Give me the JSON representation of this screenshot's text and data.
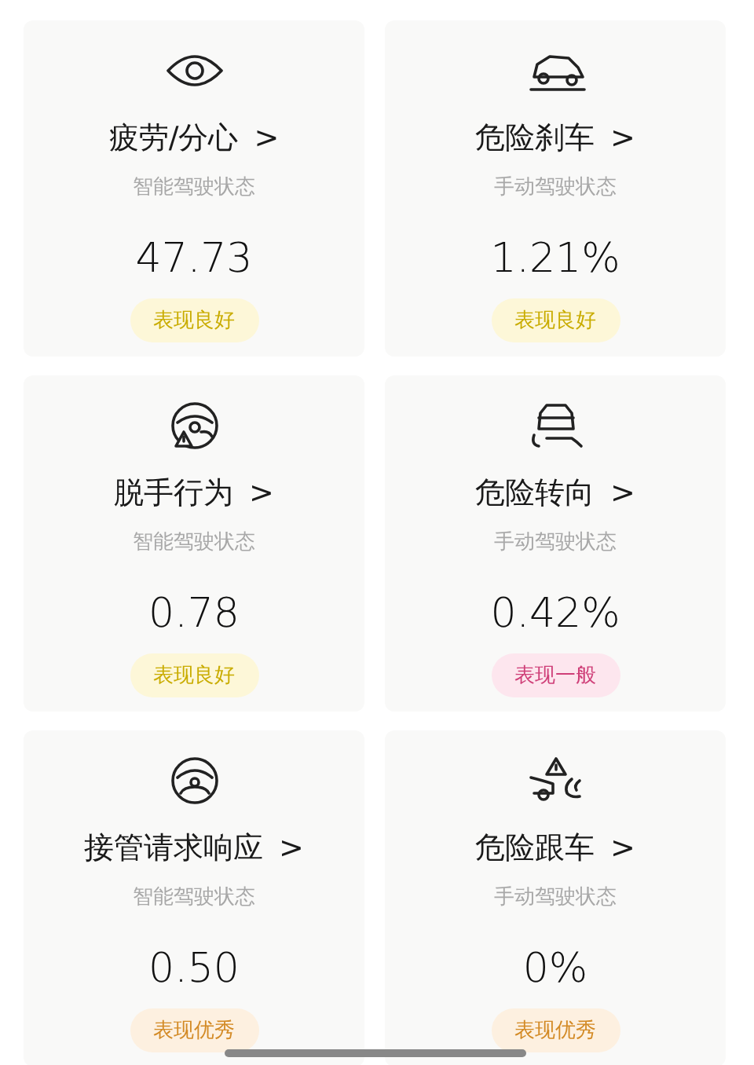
{
  "cards": [
    {
      "title": "疲劳/分心",
      "chevron": ">",
      "subtitle": "智能驾驶状态",
      "value": "47.73",
      "rating": {
        "label": "表现良好",
        "kind": "good"
      }
    },
    {
      "title": "危险刹车",
      "chevron": ">",
      "subtitle": "手动驾驶状态",
      "value": "1.21%",
      "rating": {
        "label": "表现良好",
        "kind": "good"
      }
    },
    {
      "title": "脱手行为",
      "chevron": ">",
      "subtitle": "智能驾驶状态",
      "value": "0.78",
      "rating": {
        "label": "表现良好",
        "kind": "good"
      }
    },
    {
      "title": "危险转向",
      "chevron": ">",
      "subtitle": "手动驾驶状态",
      "value": "0.42%",
      "rating": {
        "label": "表现一般",
        "kind": "average"
      }
    },
    {
      "title": "接管请求响应",
      "chevron": ">",
      "subtitle": "智能驾驶状态",
      "value": "0.50",
      "rating": {
        "label": "表现优秀",
        "kind": "excellent"
      }
    },
    {
      "title": "危险跟车",
      "chevron": ">",
      "subtitle": "手动驾驶状态",
      "value": "0%",
      "rating": {
        "label": "表现优秀",
        "kind": "excellent"
      }
    }
  ]
}
